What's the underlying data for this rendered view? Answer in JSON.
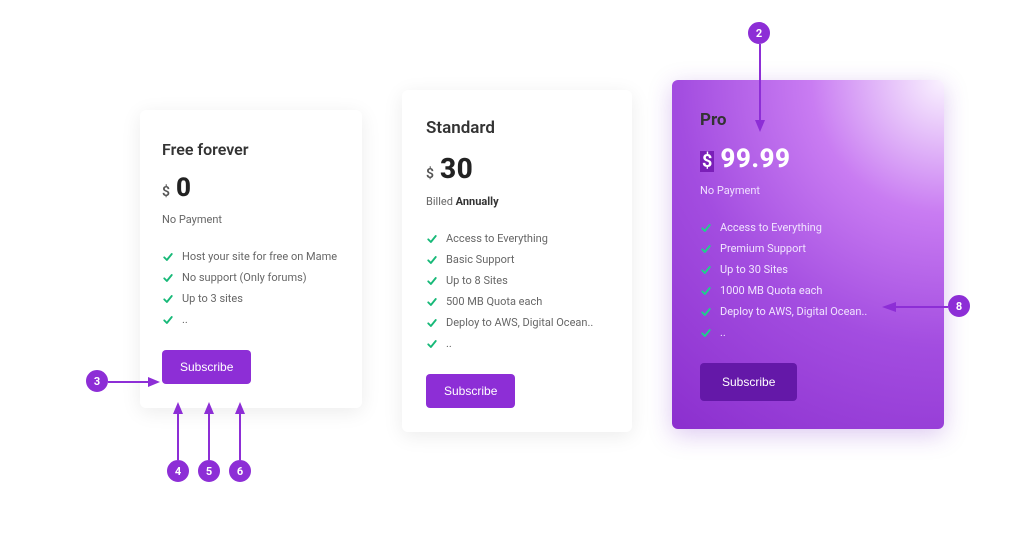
{
  "annotations": {
    "b2": "2",
    "b3": "3",
    "b4": "4",
    "b5": "5",
    "b6": "6",
    "b8": "8"
  },
  "plans": {
    "free": {
      "title": "Free forever",
      "currency": "$",
      "price": "0",
      "billing": "No Payment",
      "features": [
        "Host your site for free on Mame",
        "No support (Only forums)",
        "Up to 3 sites",
        ".."
      ],
      "cta": "Subscribe"
    },
    "standard": {
      "title": "Standard",
      "currency": "$",
      "price": "30",
      "billing_prefix": "Billed ",
      "billing_strong": "Annually",
      "features": [
        "Access to Everything",
        "Basic Support",
        "Up to 8 Sites",
        "500 MB Quota each",
        "Deploy to AWS, Digital Ocean..",
        ".."
      ],
      "cta": "Subscribe"
    },
    "pro": {
      "title": "Pro",
      "currency": "$",
      "price": "99.99",
      "billing": "No Payment",
      "features": [
        "Access to Everything",
        "Premium Support",
        "Up to 30 Sites",
        "1000 MB Quota each",
        "Deploy to AWS, Digital Ocean..",
        ".."
      ],
      "cta": "Subscribe"
    }
  }
}
